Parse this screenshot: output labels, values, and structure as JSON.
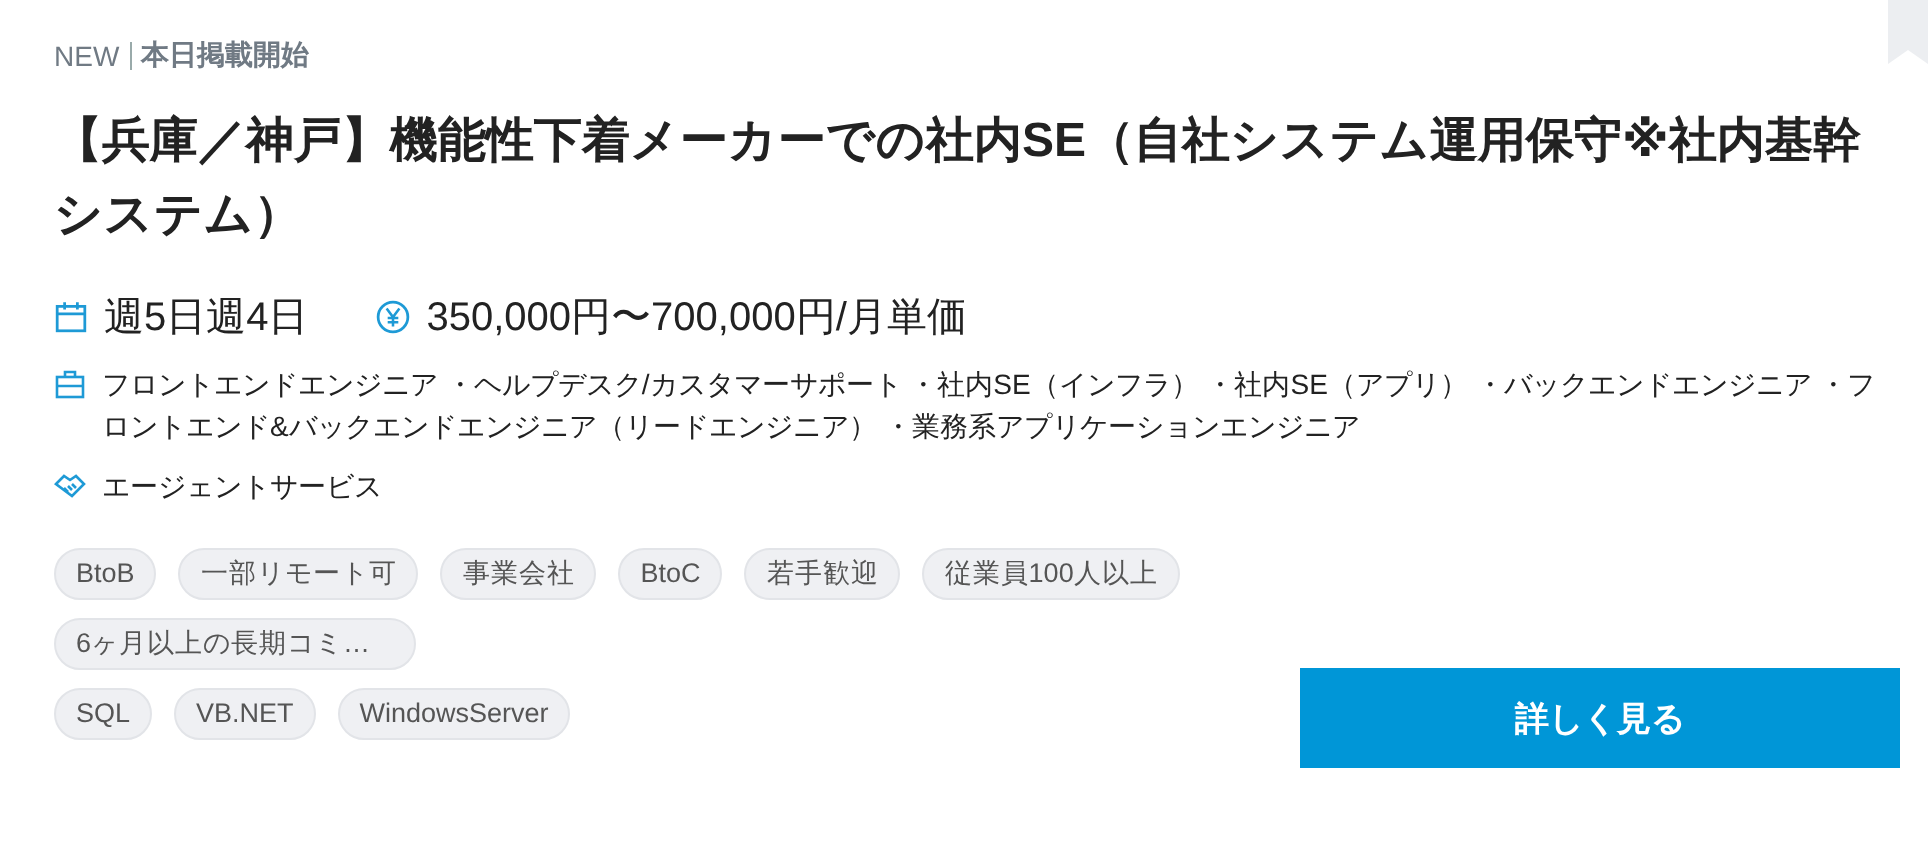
{
  "label": {
    "badge": "NEW",
    "text": "本日掲載開始"
  },
  "title": "【兵庫／神戸】機能性下着メーカーでの社内SE（自社システム運用保守※社内基幹システム）",
  "schedule": "週5日週4日",
  "price": "350,000円〜700,000円/月単価",
  "jobs": "フロントエンドエンジニア ・ヘルプデスク/カスタマーサポート ・社内SE（インフラ） ・社内SE（アプリ） ・バックエンドエンジニア ・フロントエンド&バックエンドエンジニア（リードエンジニア） ・業務系アプリケーションエンジニア",
  "agent": "エージェントサービス",
  "tags": [
    "BtoB",
    "一部リモート可",
    "事業会社",
    "BtoC",
    "若手歓迎",
    "従業員100人以上",
    "6ヶ月以上の長期コミ…"
  ],
  "skills": [
    "SQL",
    "VB.NET",
    "WindowsServer"
  ],
  "button": "詳しく見る"
}
